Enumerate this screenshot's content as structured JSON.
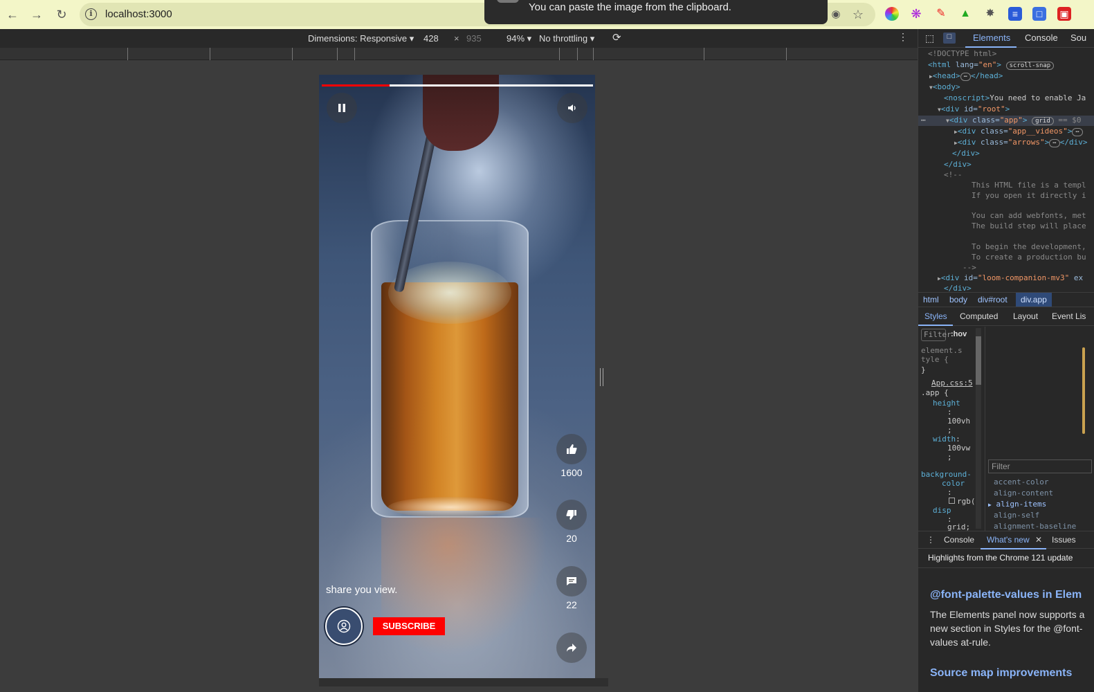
{
  "browser": {
    "url": "localhost:3000",
    "toast": "You can paste the image from the clipboard."
  },
  "device_toolbar": {
    "dimensions_label": "Dimensions: Responsive",
    "width": "428",
    "times": "×",
    "height": "935",
    "zoom": "94%",
    "throttling": "No throttling"
  },
  "video": {
    "progress_fraction": 0.25,
    "likes": "1600",
    "dislikes": "20",
    "comments": "22",
    "caption": "share you view.",
    "subscribe_label": "SUBSCRIBE",
    "accent_color": "#ff0000"
  },
  "devtools": {
    "tabs": [
      "Elements",
      "Console",
      "Sou"
    ],
    "dom": {
      "doctype": "<!DOCTYPE html>",
      "html_open": "<html",
      "html_lang_attr": " lang=",
      "html_lang_val": "\"en\"",
      "scroll_badge": "scroll-snap",
      "head": "<head>",
      "head_close": "</head>",
      "body": "<body>",
      "noscript_tag": "<noscript>",
      "noscript_text": "You need to enable Ja",
      "root_tag": "<div",
      "root_attr": " id=",
      "root_val": "\"root\"",
      "app_tag": "<div",
      "app_attr": " class=",
      "app_val": "\"app\"",
      "grid_badge": "grid",
      "eq": "== $0",
      "videos_val": "\"app__videos\"",
      "arrows_val": "\"arrows\"",
      "div_close": "</div>",
      "comment_open": "<!--",
      "c1": "This HTML file is a templ",
      "c2": "If you open it directly i",
      "c3": "You can add webfonts, met",
      "c4": "The build step will place",
      "c5": "To begin the development,",
      "c6": "To create a production bu",
      "comment_close": "-->",
      "loom_val": "\"loom-companion-mv3\"",
      "loom_after": " ex"
    },
    "crumbs": [
      "html",
      "body",
      "div#root",
      "div.app"
    ],
    "subtabs": [
      "Styles",
      "Computed",
      "Layout",
      "Event Lis"
    ],
    "styles": {
      "filter_placeholder": "Filter",
      "hov": ":hov",
      "element_style_1": "element.s",
      "element_style_2": "tyle {",
      "brace_close": "}",
      "source": "App.css:5",
      "selector": ".app {",
      "prop_height": "height",
      "colon": ":",
      "height_val": "100vh",
      "semicolon": ";",
      "prop_width": "width",
      "width_val": "100vw",
      "prop_bg_1": "background-",
      "prop_bg_2": "color",
      "bg_val": "rgb(",
      "prop_display": "disp",
      "display_val": "grid;"
    },
    "computed_filter": "Filter",
    "computed_props": [
      "accent-color",
      "align-content",
      "align-items",
      "align-self",
      "alignment-baseline"
    ],
    "drawer_tabs": [
      "Console",
      "What's new",
      "Issues"
    ],
    "whats_new": {
      "headline": "Highlights from the Chrome 121 update",
      "h1": "@font-palette-values in Elem",
      "p1a": "The Elements panel now supports a",
      "p1b": "new section in Styles for the @font-",
      "p1c": "values at-rule.",
      "h2": "Source map improvements"
    }
  }
}
